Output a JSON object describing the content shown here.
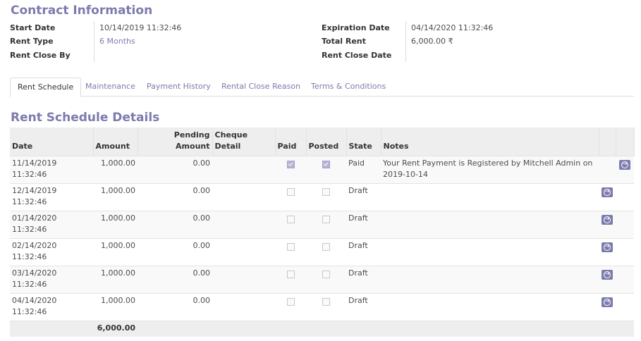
{
  "contract": {
    "title": "Contract Information",
    "start_date_label": "Start Date",
    "start_date": "10/14/2019 11:32:46",
    "rent_type_label": "Rent Type",
    "rent_type": "6 Months",
    "rent_close_by_label": "Rent Close By",
    "rent_close_by": "",
    "expiration_date_label": "Expiration Date",
    "expiration_date": "04/14/2020 11:32:46",
    "total_rent_label": "Total Rent",
    "total_rent": "6,000.00 ₹",
    "rent_close_date_label": "Rent Close Date",
    "rent_close_date": ""
  },
  "tabs": [
    "Rent Schedule",
    "Maintenance",
    "Payment History",
    "Rental Close Reason",
    "Terms & Conditions"
  ],
  "schedule": {
    "title": "Rent Schedule Details",
    "headers": {
      "date": "Date",
      "amount": "Amount",
      "pending_amount": "Pending Amount",
      "cheque_detail": "Cheque Detail",
      "paid": "Paid",
      "posted": "Posted",
      "state": "State",
      "notes": "Notes"
    },
    "rows": [
      {
        "date": "11/14/2019 11:32:46",
        "amount": "1,000.00",
        "pending": "0.00",
        "cheque": "",
        "paid": true,
        "posted": true,
        "state": "Paid",
        "notes": "Your Rent Payment is Registered by Mitchell Admin on 2019-10-14"
      },
      {
        "date": "12/14/2019 11:32:46",
        "amount": "1,000.00",
        "pending": "0.00",
        "cheque": "",
        "paid": false,
        "posted": false,
        "state": "Draft",
        "notes": ""
      },
      {
        "date": "01/14/2020 11:32:46",
        "amount": "1,000.00",
        "pending": "0.00",
        "cheque": "",
        "paid": false,
        "posted": false,
        "state": "Draft",
        "notes": ""
      },
      {
        "date": "02/14/2020 11:32:46",
        "amount": "1,000.00",
        "pending": "0.00",
        "cheque": "",
        "paid": false,
        "posted": false,
        "state": "Draft",
        "notes": ""
      },
      {
        "date": "03/14/2020 11:32:46",
        "amount": "1,000.00",
        "pending": "0.00",
        "cheque": "",
        "paid": false,
        "posted": false,
        "state": "Draft",
        "notes": ""
      },
      {
        "date": "04/14/2020 11:32:46",
        "amount": "1,000.00",
        "pending": "0.00",
        "cheque": "",
        "paid": false,
        "posted": false,
        "state": "Draft",
        "notes": ""
      }
    ],
    "total_amount": "6,000.00"
  },
  "colors": {
    "accent": "#7c7bad",
    "header_bg": "#eeeeee"
  }
}
